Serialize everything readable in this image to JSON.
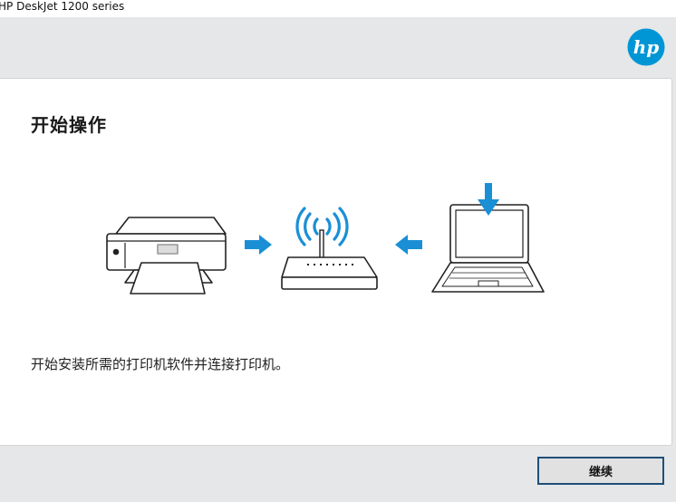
{
  "window": {
    "title": "HP DeskJet 1200 series"
  },
  "brand": {
    "logo_text": "hp",
    "color": "#0096d6"
  },
  "page": {
    "title": "开始操作",
    "description": "开始安装所需的打印机软件并连接打印机。"
  },
  "actions": {
    "continue_label": "继续"
  },
  "illustration": {
    "icons": [
      "printer-icon",
      "arrow-right-icon",
      "wifi-router-icon",
      "arrow-left-icon",
      "laptop-icon",
      "download-arrow-icon"
    ],
    "accent_color": "#1a8fd6",
    "line_color": "#222222"
  }
}
